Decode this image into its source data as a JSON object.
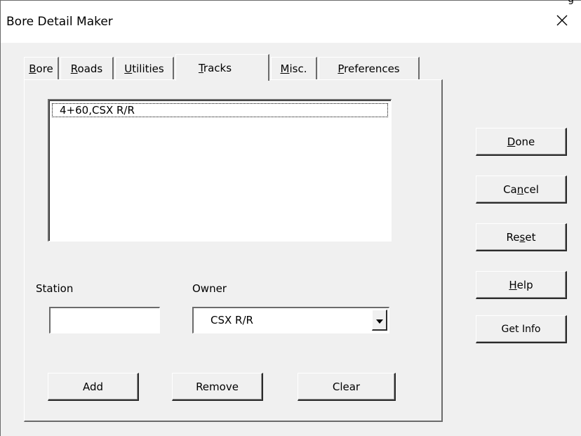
{
  "window": {
    "title": "Bore Detail Maker",
    "title_clip_text": "g",
    "close_glyph": "✕"
  },
  "tabs": [
    {
      "label": "Bore",
      "underline_index": 0,
      "active": false
    },
    {
      "label": "Roads",
      "underline_index": 0,
      "active": false
    },
    {
      "label": "Utilities",
      "underline_index": 0,
      "active": false
    },
    {
      "label": "Tracks",
      "underline_index": 0,
      "active": true
    },
    {
      "label": "Misc.",
      "underline_index": 0,
      "active": false
    },
    {
      "label": "Preferences",
      "underline_index": 0,
      "active": false
    }
  ],
  "tracks": {
    "list_items": [
      "4+60,CSX R/R"
    ],
    "station_label": "Station",
    "station_value": "",
    "owner_label": "Owner",
    "owner_value": "CSX R/R",
    "add_label": "Add",
    "remove_label": "Remove",
    "clear_label": "Clear"
  },
  "side_buttons": {
    "done": {
      "label": "Done",
      "underline_index": 0
    },
    "cancel": {
      "label": "Cancel",
      "underline_index": 2
    },
    "reset": {
      "label": "Reset",
      "underline_index": 2
    },
    "help": {
      "label": "Help",
      "underline_index": 0
    },
    "get_info": {
      "label": "Get Info",
      "underline_index": -1
    }
  },
  "icons": {
    "close": "close-icon",
    "dropdown": "chevron-down-icon"
  }
}
